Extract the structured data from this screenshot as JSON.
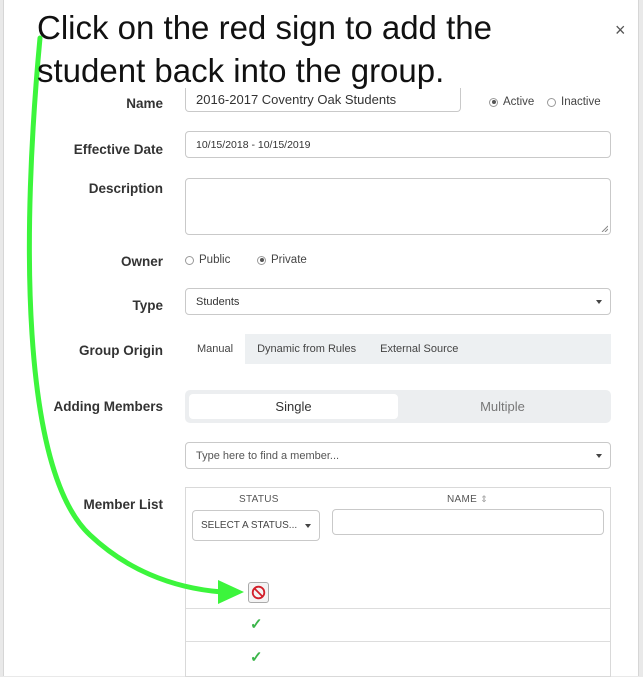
{
  "annotation": {
    "line1": "Click on the red sign to add the",
    "line2": "student back into the group."
  },
  "close_glyph": "×",
  "form": {
    "name_label": "Name",
    "name_value": "2016-2017 Coventry Oak Students",
    "status_active": "Active",
    "status_inactive": "Inactive",
    "effective_date_label": "Effective Date",
    "effective_date_value": "10/15/2018 - 10/15/2019",
    "description_label": "Description",
    "description_value": "",
    "owner_label": "Owner",
    "owner_public": "Public",
    "owner_private": "Private",
    "type_label": "Type",
    "type_value": "Students",
    "group_origin_label": "Group Origin",
    "origin_tabs": [
      "Manual",
      "Dynamic from Rules",
      "External Source"
    ],
    "adding_members_label": "Adding Members",
    "adding_single": "Single",
    "adding_multiple": "Multiple",
    "member_search_placeholder": "Type here to find a member...",
    "member_list_label": "Member List"
  },
  "member_table": {
    "status_header": "STATUS",
    "name_header": "NAME",
    "sort_glyph": "⇕",
    "status_select": "SELECT A STATUS...",
    "name_filter": "",
    "check_glyph": "✓"
  },
  "colors": {
    "arrow": "#3cf53c",
    "red_sign": "#d21f2a",
    "check": "#3bb54a"
  }
}
